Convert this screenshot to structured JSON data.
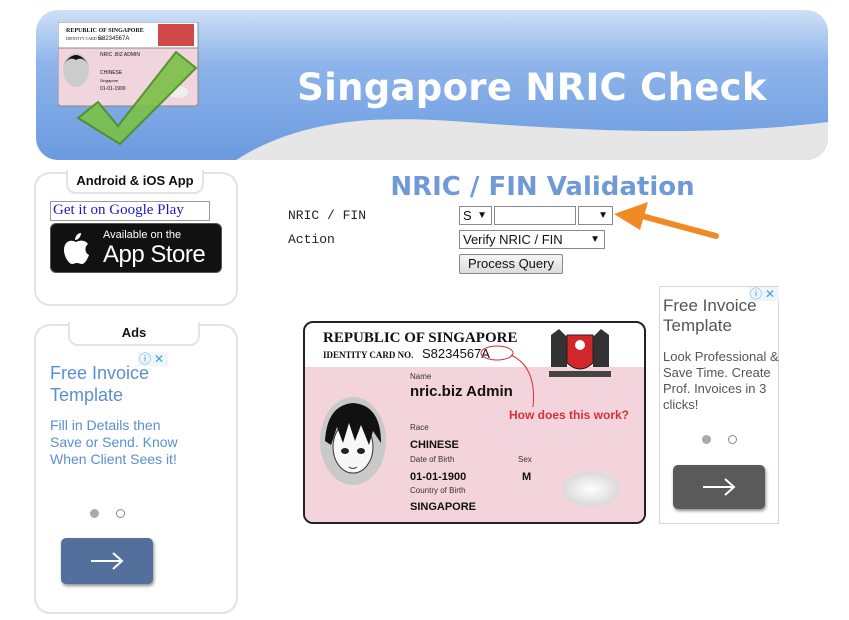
{
  "header": {
    "title": "Singapore NRIC Check",
    "logo_card": {
      "line1": "REPUBLIC OF SINGAPORE",
      "line2": "IDENTITY CARD NO.",
      "id": "S8234567A",
      "name": "NRIC .BIZ ADMIN",
      "race": "CHINESE",
      "country": "Singapore",
      "dob": "01-01-1900"
    }
  },
  "app_box": {
    "title": "Android & iOS App",
    "google_play": "Get it on Google Play",
    "app_store_small": "Available on the",
    "app_store_big": "App Store"
  },
  "ads_box": {
    "title": "Ads",
    "ad_title": "Free Invoice Template",
    "ad_text": "Fill in Details then Save or Send. Know When Client Sees it!"
  },
  "form": {
    "heading": "NRIC / FIN Validation",
    "nric_label": "NRIC / FIN",
    "action_label": "Action",
    "prefix_value": "S",
    "number_value": "",
    "suffix_value": "",
    "action_value": "Verify NRIC / FIN",
    "submit_label": "Process Query"
  },
  "right_ad": {
    "ad_title": "Free Invoice Template",
    "ad_text": "Look Professional & Save Time. Create Prof. Invoices in 3 clicks!"
  },
  "id_card": {
    "line1": "REPUBLIC OF SINGAPORE",
    "line2": "IDENTITY CARD NO.",
    "id": "S8234567A",
    "name_label": "Name",
    "name": "nric.biz Admin",
    "help": "How does this work?",
    "race_label": "Race",
    "race": "CHINESE",
    "dob_label": "Date of Birth",
    "dob": "01-01-1900",
    "sex_label": "Sex",
    "sex": "M",
    "cob_label": "Country of Birth",
    "cob": "SINGAPORE"
  },
  "colors": {
    "banner_blue": "#6a9ae0",
    "heading_blue": "#7099d8",
    "ad_text_blue": "#5a8fd1",
    "arrow_orange": "#f08a24",
    "card_pink": "#f4d4dc",
    "help_red": "#d2313a"
  }
}
